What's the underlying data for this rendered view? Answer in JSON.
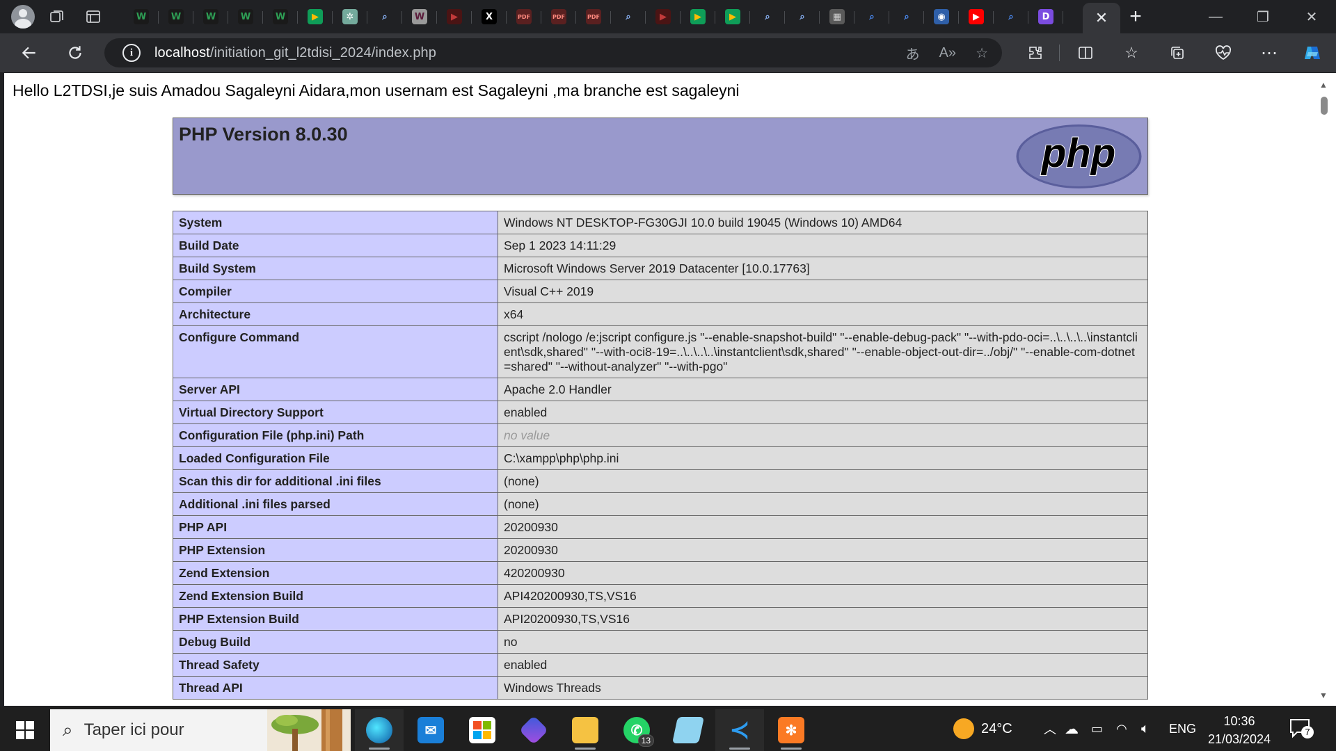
{
  "browser": {
    "tabs": [
      {
        "icon": "profile-tabs-icon",
        "label": "W",
        "bg": "#1a1a1a",
        "fg": "#2e9f55"
      },
      {
        "icon": "w-icon",
        "label": "W",
        "bg": "#1a1a1a",
        "fg": "#2e9f55"
      },
      {
        "icon": "w-icon",
        "label": "W",
        "bg": "#1a1a1a",
        "fg": "#2e9f55"
      },
      {
        "icon": "w-icon",
        "label": "W",
        "bg": "#1a1a1a",
        "fg": "#2e9f55"
      },
      {
        "icon": "w-icon",
        "label": "W",
        "bg": "#1a1a1a",
        "fg": "#2e9f55"
      },
      {
        "icon": "meet-icon",
        "label": "▶",
        "bg": "#0f9d58",
        "fg": "#fbbc04"
      },
      {
        "icon": "chatgpt-icon",
        "label": "✲",
        "bg": "#74aa9c",
        "fg": "#ffffff"
      },
      {
        "icon": "search-icon",
        "label": "⌕",
        "bg": "#202124",
        "fg": "#8ab4f8"
      },
      {
        "icon": "w-dark-icon",
        "label": "W",
        "bg": "#9a9a9a",
        "fg": "#5a1a3a"
      },
      {
        "icon": "youtube-icon",
        "label": "▶",
        "bg": "#4a1414",
        "fg": "#c23a3a"
      },
      {
        "icon": "x-icon",
        "label": "X",
        "bg": "#000000",
        "fg": "#ffffff"
      },
      {
        "icon": "pdf-icon",
        "label": "PDF",
        "bg": "#5a2020",
        "fg": "#ff8a80"
      },
      {
        "icon": "pdf-icon",
        "label": "PDF",
        "bg": "#5a2020",
        "fg": "#ff8a80"
      },
      {
        "icon": "pdf-icon",
        "label": "PDF",
        "bg": "#5a2020",
        "fg": "#ff8a80"
      },
      {
        "icon": "search-icon",
        "label": "⌕",
        "bg": "#202124",
        "fg": "#8ab4f8"
      },
      {
        "icon": "youtube-icon",
        "label": "▶",
        "bg": "#4a1414",
        "fg": "#c23a3a"
      },
      {
        "icon": "meet-icon",
        "label": "▶",
        "bg": "#0f9d58",
        "fg": "#fbbc04"
      },
      {
        "icon": "meet-icon",
        "label": "▶",
        "bg": "#0f9d58",
        "fg": "#fbbc04"
      },
      {
        "icon": "search-icon",
        "label": "⌕",
        "bg": "#202124",
        "fg": "#8ab4f8"
      },
      {
        "icon": "search-icon",
        "label": "⌕",
        "bg": "#202124",
        "fg": "#8ab4f8"
      },
      {
        "icon": "grid-icon",
        "label": "▦",
        "bg": "#5a5a5a",
        "fg": "#d0d0d0"
      },
      {
        "icon": "search-icon",
        "label": "⌕",
        "bg": "#202124",
        "fg": "#4b8df8"
      },
      {
        "icon": "search-icon",
        "label": "⌕",
        "bg": "#202124",
        "fg": "#4b8df8"
      },
      {
        "icon": "github-icon",
        "label": "◉",
        "bg": "#2f5fa8",
        "fg": "#ffffff"
      },
      {
        "icon": "youtube-icon",
        "label": "▶",
        "bg": "#ff0000",
        "fg": "#ffffff"
      },
      {
        "icon": "search-icon",
        "label": "⌕",
        "bg": "#202124",
        "fg": "#4b8df8"
      },
      {
        "icon": "d-icon",
        "label": "D",
        "bg": "#7b4ce0",
        "fg": "#ffffff"
      }
    ],
    "address": {
      "host": "localhost",
      "path": "/initiation_git_l2tdisi_2024/index.php"
    }
  },
  "page": {
    "greeting": "Hello L2TDSI,je suis Amadou Sagaleyni Aidara,mon usernam est Sagaleyni ,ma branche est sagaleyni",
    "php_version_title": "PHP Version 8.0.30",
    "logo_text": "php",
    "rows": [
      {
        "key": "System",
        "value": "Windows NT DESKTOP-FG30GJI 10.0 build 19045 (Windows 10) AMD64"
      },
      {
        "key": "Build Date",
        "value": "Sep 1 2023 14:11:29"
      },
      {
        "key": "Build System",
        "value": "Microsoft Windows Server 2019 Datacenter [10.0.17763]"
      },
      {
        "key": "Compiler",
        "value": "Visual C++ 2019"
      },
      {
        "key": "Architecture",
        "value": "x64"
      },
      {
        "key": "Configure Command",
        "value": "cscript /nologo /e:jscript configure.js \"--enable-snapshot-build\" \"--enable-debug-pack\" \"--with-pdo-oci=..\\..\\..\\..\\instantclient\\sdk,shared\" \"--with-oci8-19=..\\..\\..\\..\\instantclient\\sdk,shared\" \"--enable-object-out-dir=../obj/\" \"--enable-com-dotnet=shared\" \"--without-analyzer\" \"--with-pgo\""
      },
      {
        "key": "Server API",
        "value": "Apache 2.0 Handler"
      },
      {
        "key": "Virtual Directory Support",
        "value": "enabled"
      },
      {
        "key": "Configuration File (php.ini) Path",
        "value": "no value",
        "novalue": true
      },
      {
        "key": "Loaded Configuration File",
        "value": "C:\\xampp\\php\\php.ini"
      },
      {
        "key": "Scan this dir for additional .ini files",
        "value": "(none)"
      },
      {
        "key": "Additional .ini files parsed",
        "value": "(none)"
      },
      {
        "key": "PHP API",
        "value": "20200930"
      },
      {
        "key": "PHP Extension",
        "value": "20200930"
      },
      {
        "key": "Zend Extension",
        "value": "420200930"
      },
      {
        "key": "Zend Extension Build",
        "value": "API420200930,TS,VS16"
      },
      {
        "key": "PHP Extension Build",
        "value": "API20200930,TS,VS16"
      },
      {
        "key": "Debug Build",
        "value": "no"
      },
      {
        "key": "Thread Safety",
        "value": "enabled"
      },
      {
        "key": "Thread API",
        "value": "Windows Threads"
      }
    ]
  },
  "taskbar": {
    "search_placeholder": "Taper ici pour",
    "whatsapp_badge": "13",
    "weather": "24°C",
    "language": "ENG",
    "time": "10:36",
    "date": "21/03/2024",
    "notification_count": "7"
  },
  "colors": {
    "php_header": "#9999cc",
    "key_cell": "#ccccff",
    "value_cell": "#dddddd",
    "logo_fill": "#777bb3"
  }
}
